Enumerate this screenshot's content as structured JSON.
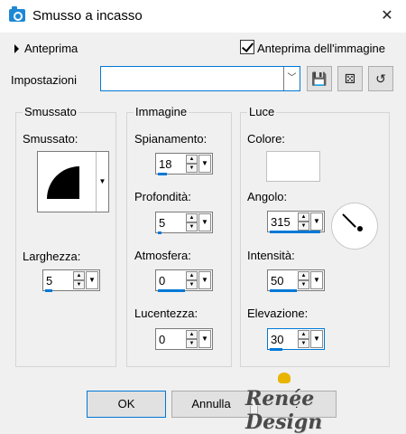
{
  "window": {
    "title": "Smusso a incasso",
    "close_glyph": "✕"
  },
  "preview": {
    "toggle_label": "Anteprima",
    "checkbox_label": "Anteprima dell'immagine",
    "checked": true
  },
  "settings": {
    "label": "Impostazioni",
    "value": "",
    "icons": [
      "save-icon",
      "randomize-dice-icon",
      "reset-icon"
    ]
  },
  "groups": {
    "bevel": {
      "title": "Smussato",
      "shape_label": "Smussato:",
      "width_label": "Larghezza:",
      "width_value": "5"
    },
    "image": {
      "title": "Immagine",
      "smoothness_label": "Spianamento:",
      "smoothness_value": "18",
      "depth_label": "Profondità:",
      "depth_value": "5",
      "ambience_label": "Atmosfera:",
      "ambience_value": "0",
      "shininess_label": "Lucentezza:",
      "shininess_value": "0"
    },
    "light": {
      "title": "Luce",
      "color_label": "Colore:",
      "color_value": "#ffffff",
      "angle_label": "Angolo:",
      "angle_value": "315",
      "intensity_label": "Intensità:",
      "intensity_value": "50",
      "elevation_label": "Elevazione:",
      "elevation_value": "30"
    }
  },
  "buttons": {
    "ok": "OK",
    "cancel": "Annulla",
    "help": "?"
  },
  "watermark": {
    "text": "Renée Design"
  },
  "colors": {
    "accent": "#0078d7"
  }
}
